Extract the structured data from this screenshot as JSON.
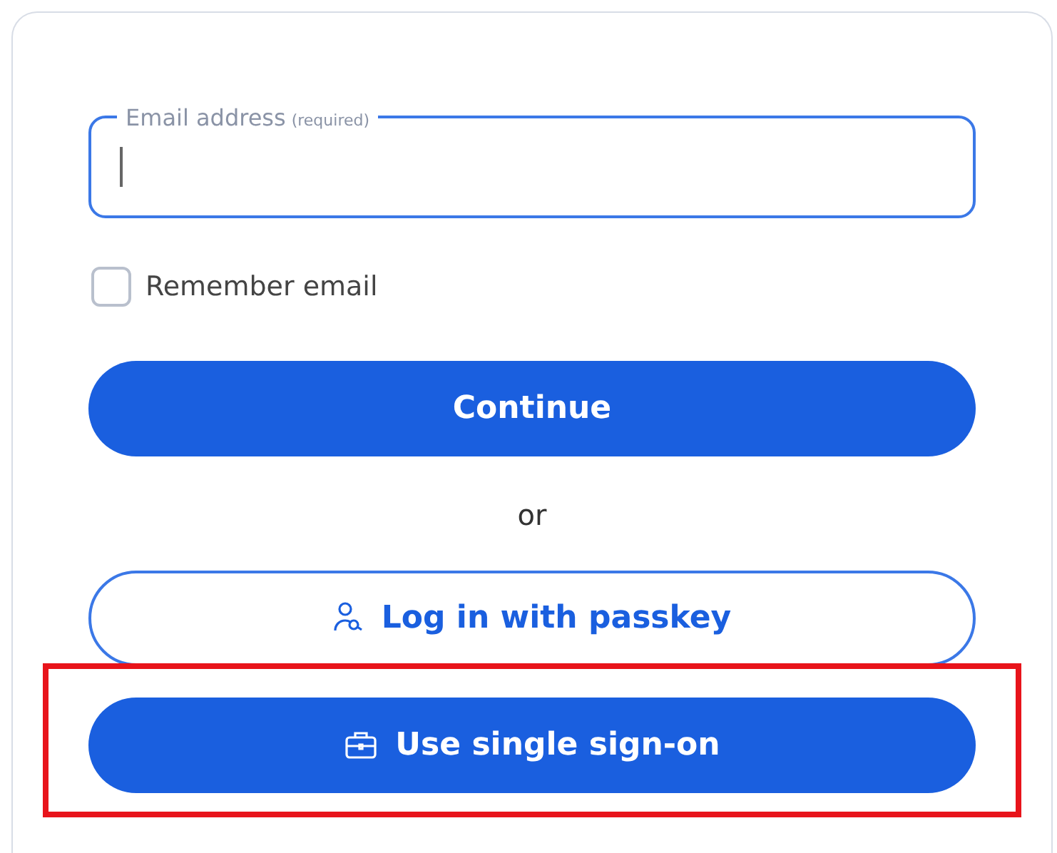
{
  "email_field": {
    "label": "Email address",
    "hint": "(required)",
    "focused": true
  },
  "remember": {
    "label": "Remember email",
    "checked": false
  },
  "continue_button": {
    "label": "Continue"
  },
  "divider": {
    "label": "or"
  },
  "buttons": [
    {
      "kind": "outline",
      "label": "Log in with passkey",
      "highlighted": false
    },
    {
      "kind": "filled",
      "label": "Use single sign-on",
      "highlighted": true
    }
  ]
}
